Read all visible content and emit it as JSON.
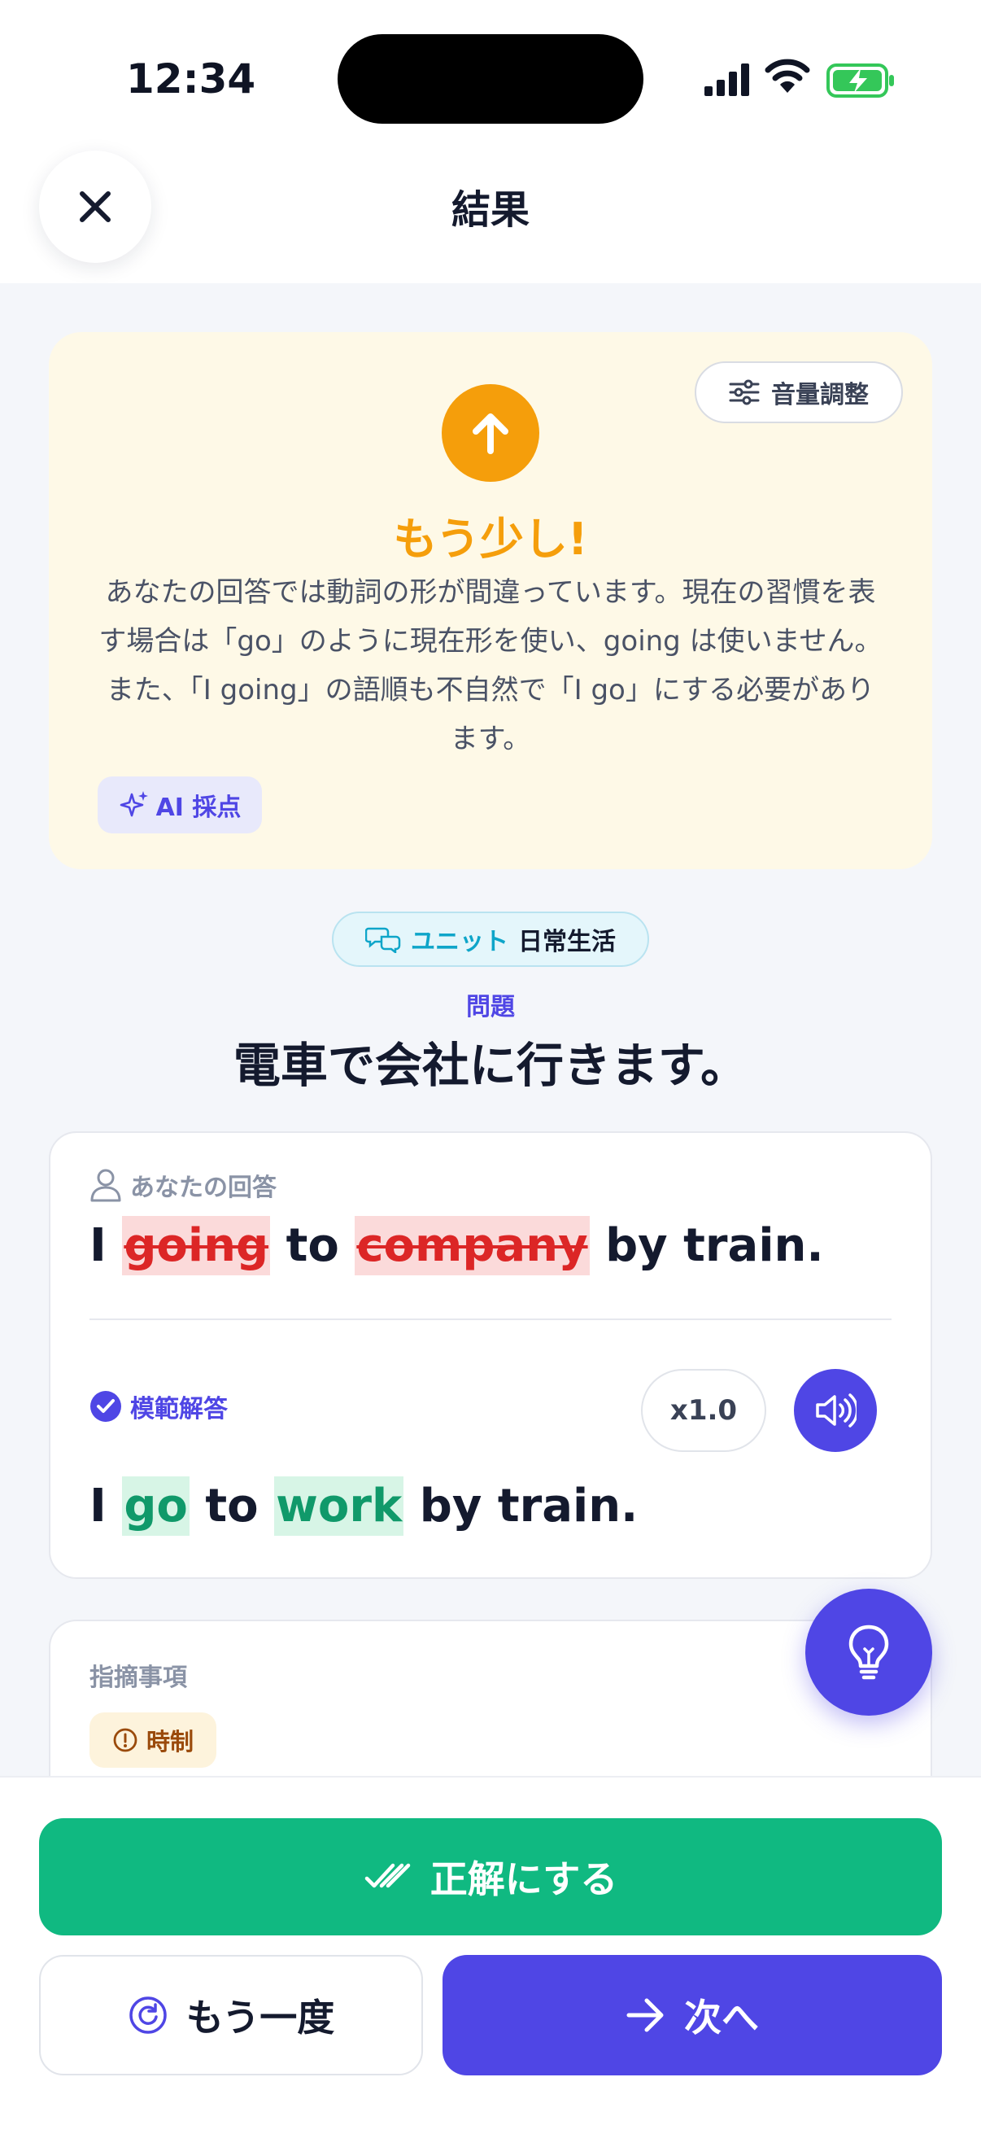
{
  "status_bar": {
    "time": "12:34"
  },
  "header": {
    "title": "結果"
  },
  "feedback": {
    "volume_label": "音量調整",
    "verdict": "もう少し!",
    "explanation": "あなたの回答では動詞の形が間違っています。現在の習慣を表す場合は「go」のように現在形を使い、going は使いません。また、「I going」の語順も不自然で「I go」にする必要があります。",
    "ai_badge": "AI 採点"
  },
  "unit": {
    "label": "ユニット",
    "name": "日常生活"
  },
  "question": {
    "label": "問題",
    "text": "電車で会社に行きます。"
  },
  "user_answer": {
    "label": "あなたの回答",
    "tokens": [
      "I",
      "going",
      "to",
      "company",
      "by train."
    ]
  },
  "model_answer": {
    "label": "模範解答",
    "speed": "x1.0",
    "tokens": [
      "I",
      "go",
      "to",
      "work",
      "by train."
    ]
  },
  "notes": {
    "title": "指摘事項",
    "chip": "時制"
  },
  "actions": {
    "mark_correct": "正解にする",
    "retry": "もう一度",
    "next": "次へ"
  },
  "colors": {
    "primary": "#4f46e5",
    "success": "#10b981",
    "warning": "#f59e0b",
    "error": "#dc2626"
  }
}
